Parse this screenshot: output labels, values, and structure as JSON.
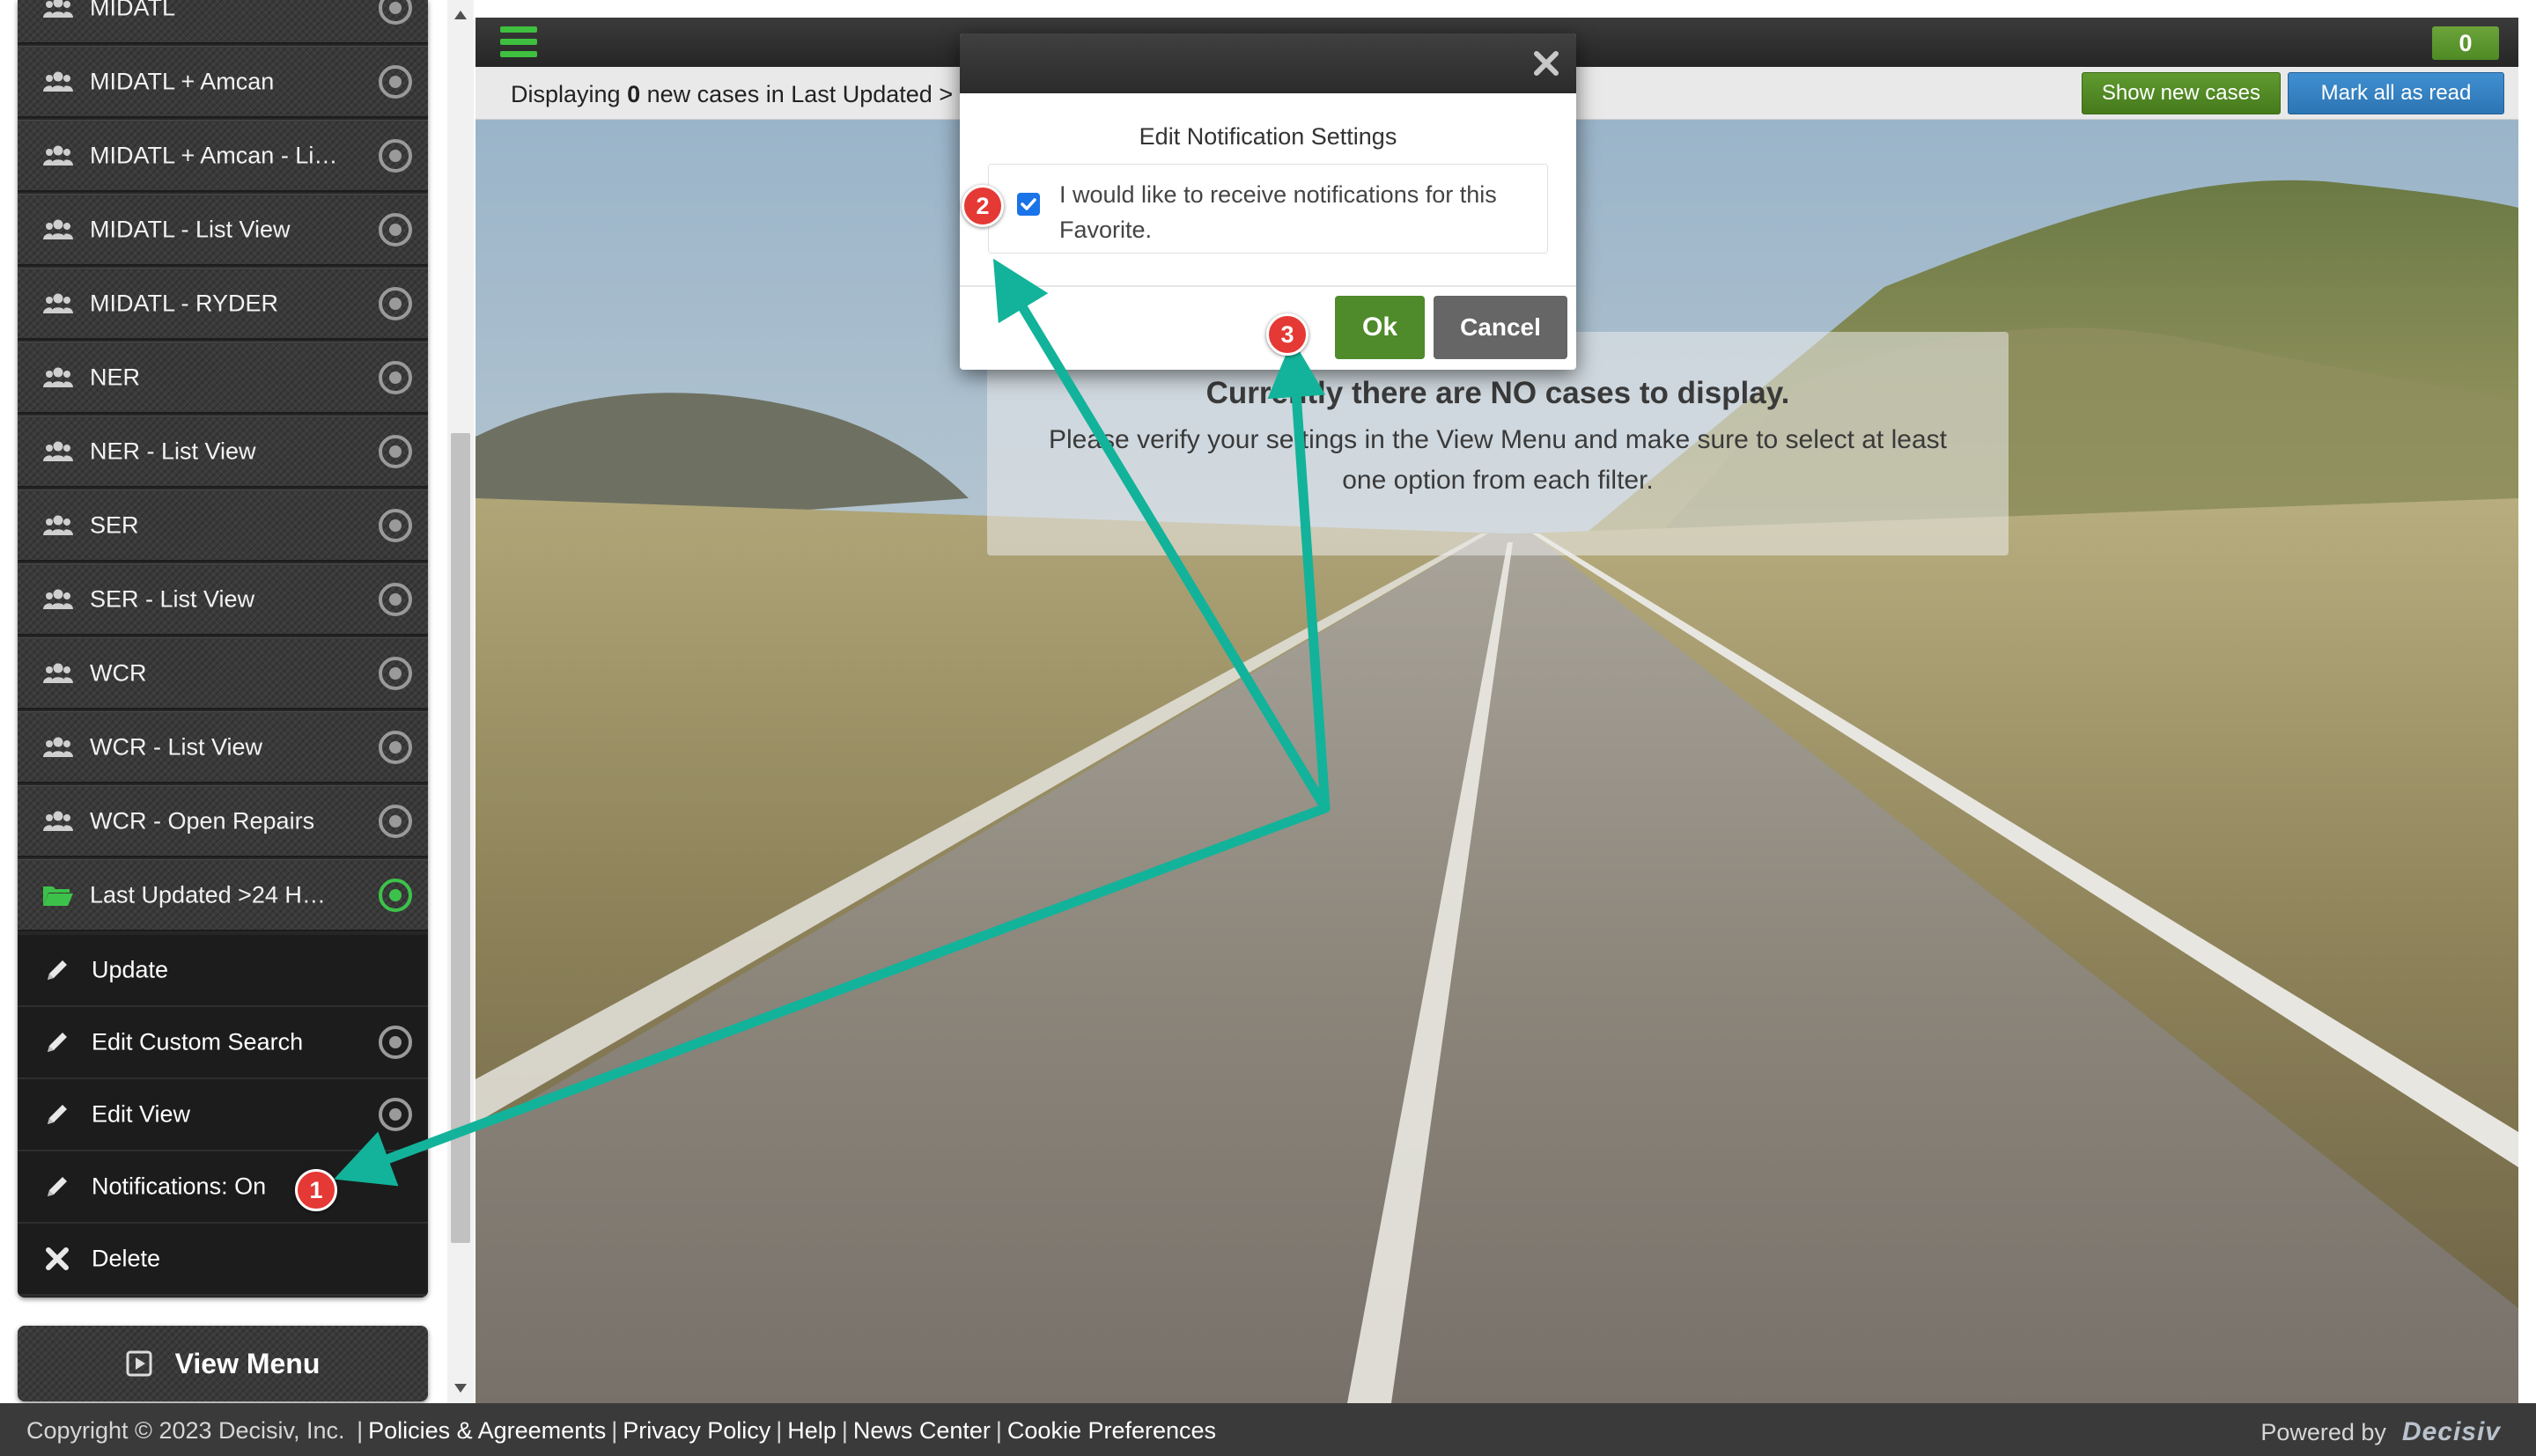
{
  "sidebar": {
    "items": [
      {
        "label": "MIDATL",
        "icon": "group-icon",
        "selected": false
      },
      {
        "label": "MIDATL + Amcan",
        "icon": "group-icon",
        "selected": false
      },
      {
        "label": "MIDATL + Amcan - Li…",
        "icon": "group-icon",
        "selected": false
      },
      {
        "label": "MIDATL - List View",
        "icon": "group-icon",
        "selected": false
      },
      {
        "label": "MIDATL - RYDER",
        "icon": "group-icon",
        "selected": false
      },
      {
        "label": "NER",
        "icon": "group-icon",
        "selected": false
      },
      {
        "label": "NER - List View",
        "icon": "group-icon",
        "selected": false
      },
      {
        "label": "SER",
        "icon": "group-icon",
        "selected": false
      },
      {
        "label": "SER - List View",
        "icon": "group-icon",
        "selected": false
      },
      {
        "label": "WCR",
        "icon": "group-icon",
        "selected": false
      },
      {
        "label": "WCR - List View",
        "icon": "group-icon",
        "selected": false
      },
      {
        "label": "WCR - Open Repairs",
        "icon": "group-icon",
        "selected": false
      },
      {
        "label": "Last Updated >24 H…",
        "icon": "folder-open-icon",
        "selected": true
      }
    ],
    "submenu": [
      {
        "label": "Update",
        "icon": "pencil-icon",
        "has_radio": false
      },
      {
        "label": "Edit Custom Search",
        "icon": "pencil-icon",
        "has_radio": true
      },
      {
        "label": "Edit View",
        "icon": "pencil-icon",
        "has_radio": true
      },
      {
        "label": "Notifications: On",
        "icon": "pencil-icon",
        "has_radio": false
      },
      {
        "label": "Delete",
        "icon": "x-icon",
        "has_radio": false
      }
    ],
    "view_menu_label": "View Menu"
  },
  "topbar": {
    "count": "0"
  },
  "subbar": {
    "status_prefix": "Displaying",
    "status_count": "0",
    "status_suffix": "new cases in Last Updated >",
    "show_new_label": "Show new cases",
    "mark_read_label": "Mark all as read"
  },
  "empty_state": {
    "headline": "Currently there are NO cases to display.",
    "message": "Please verify your settings in the View Menu and make sure to select at least one option from each filter."
  },
  "modal": {
    "title": "Edit Notification Settings",
    "checkbox_label": "I would like to receive notifications for this Favorite.",
    "checkbox_checked": true,
    "ok_label": "Ok",
    "cancel_label": "Cancel"
  },
  "footer": {
    "copyright": "Copyright © 2023 Decisiv, Inc.",
    "links": [
      "Policies & Agreements",
      "Privacy Policy",
      "Help",
      "News Center",
      "Cookie Preferences"
    ],
    "powered_by": "Powered by",
    "brand": "Decisiv"
  },
  "annotations": {
    "callout_1": "1",
    "callout_2": "2",
    "callout_3": "3",
    "arrow_color": "#12b39a",
    "callout_color": "#e53935"
  },
  "colors": {
    "accent_green": "#3cc24a",
    "button_blue": "#2d75b4",
    "ok_green": "#4f8a2b"
  }
}
